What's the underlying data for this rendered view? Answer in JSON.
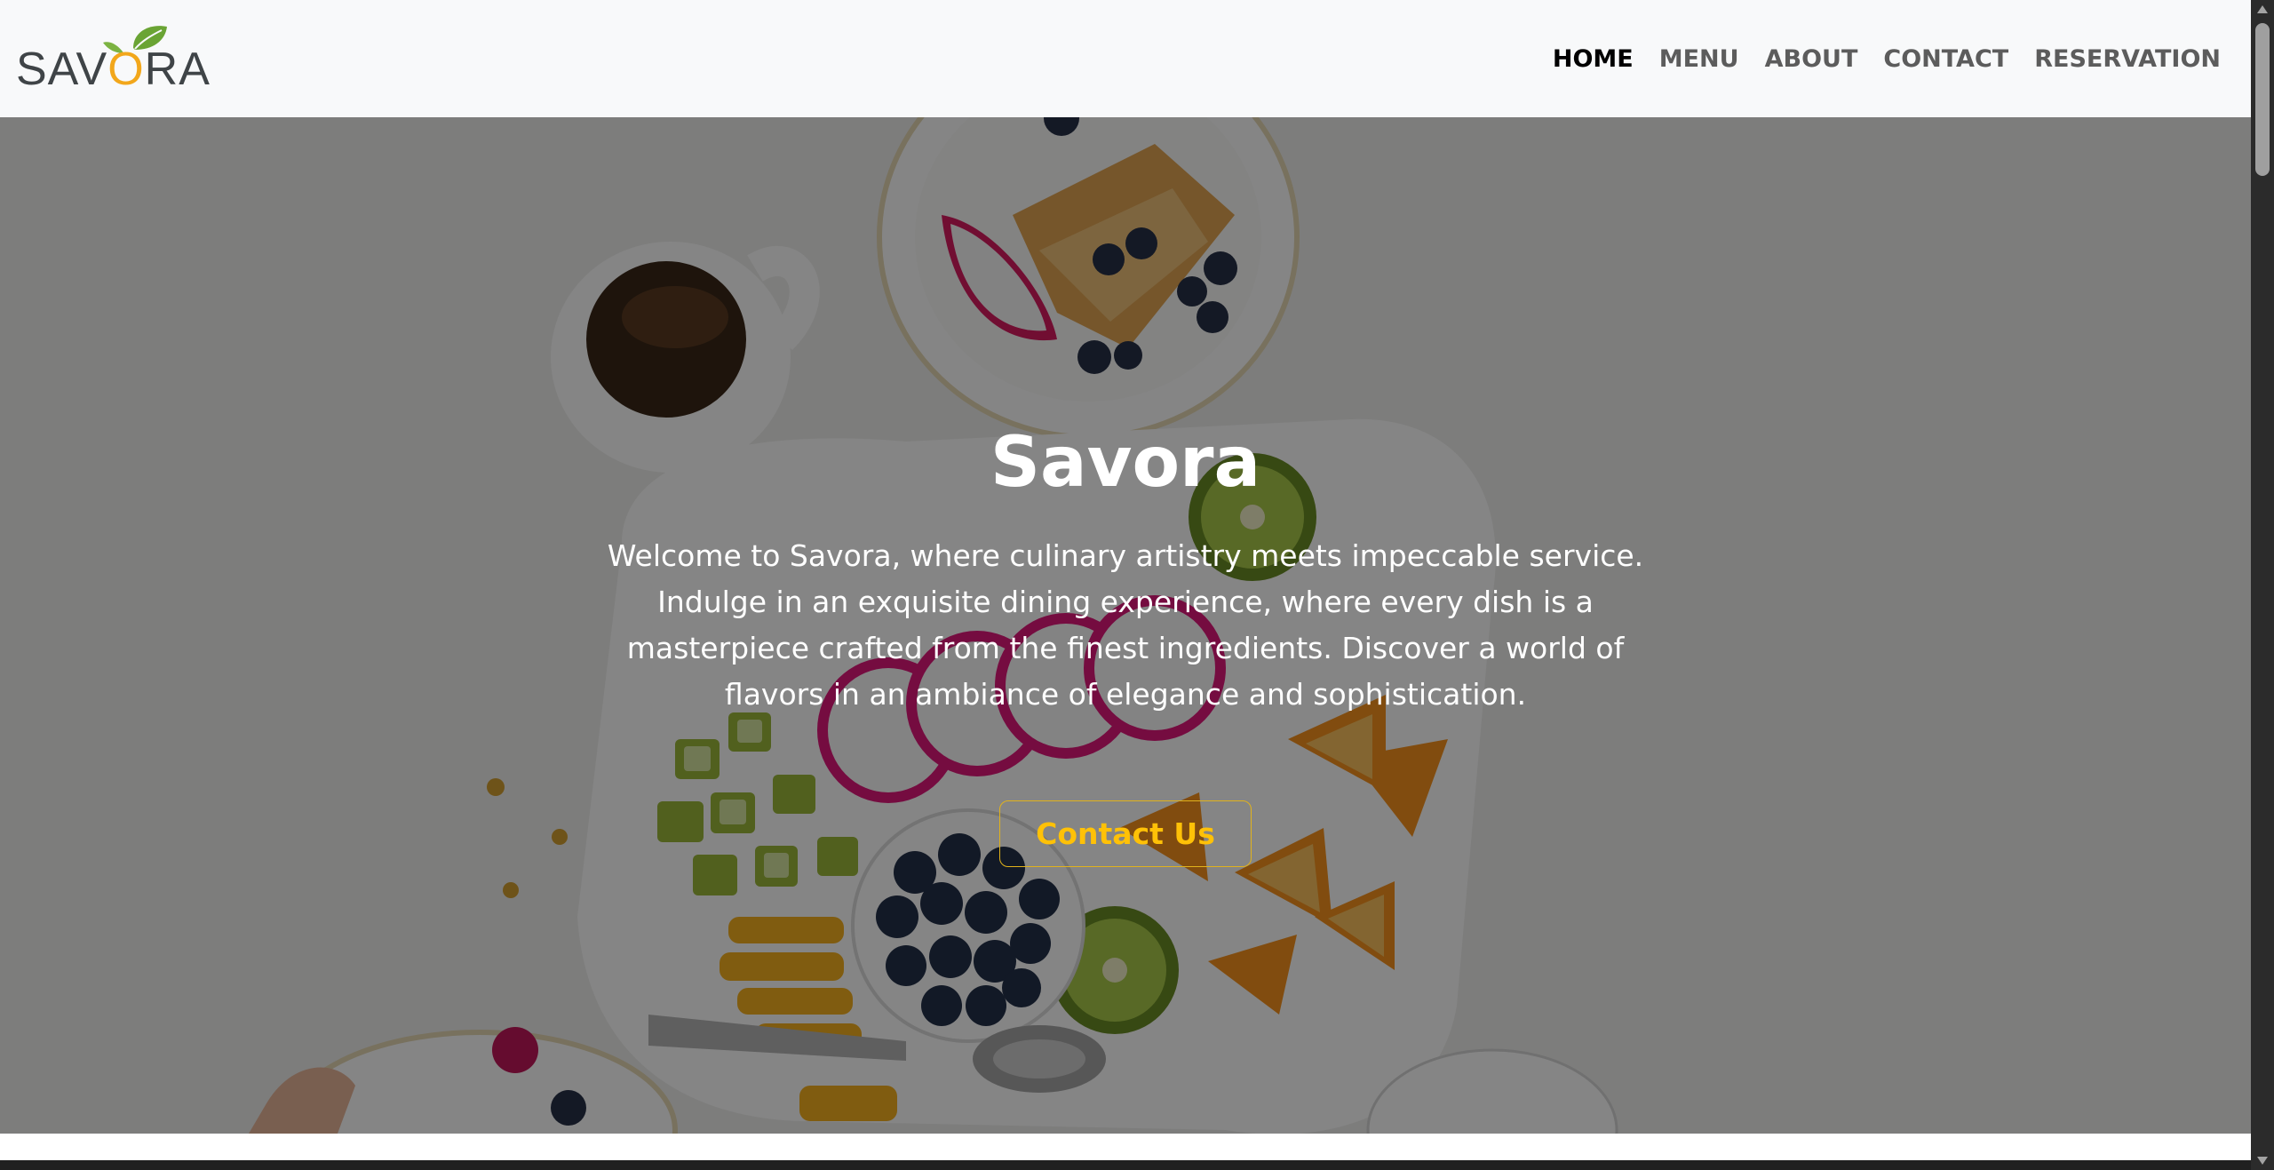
{
  "brand": {
    "name": "SAVORA",
    "accent_color": "#f2a71b",
    "leaf_color": "#6aa434"
  },
  "nav": {
    "items": [
      {
        "label": "HOME",
        "active": true
      },
      {
        "label": "MENU",
        "active": false
      },
      {
        "label": "ABOUT",
        "active": false
      },
      {
        "label": "CONTACT",
        "active": false
      },
      {
        "label": "RESERVATION",
        "active": false
      }
    ]
  },
  "hero": {
    "title": "Savora",
    "description": "Welcome to Savora, where culinary artistry meets impeccable service. Indulge in an exquisite dining experience, where every dish is a masterpiece crafted from the finest ingredients. Discover a world of flavors in an ambiance of elegance and sophistication.",
    "button_label": "Contact Us",
    "button_color": "#ffc107",
    "background_icon": "food-platter-photo"
  }
}
